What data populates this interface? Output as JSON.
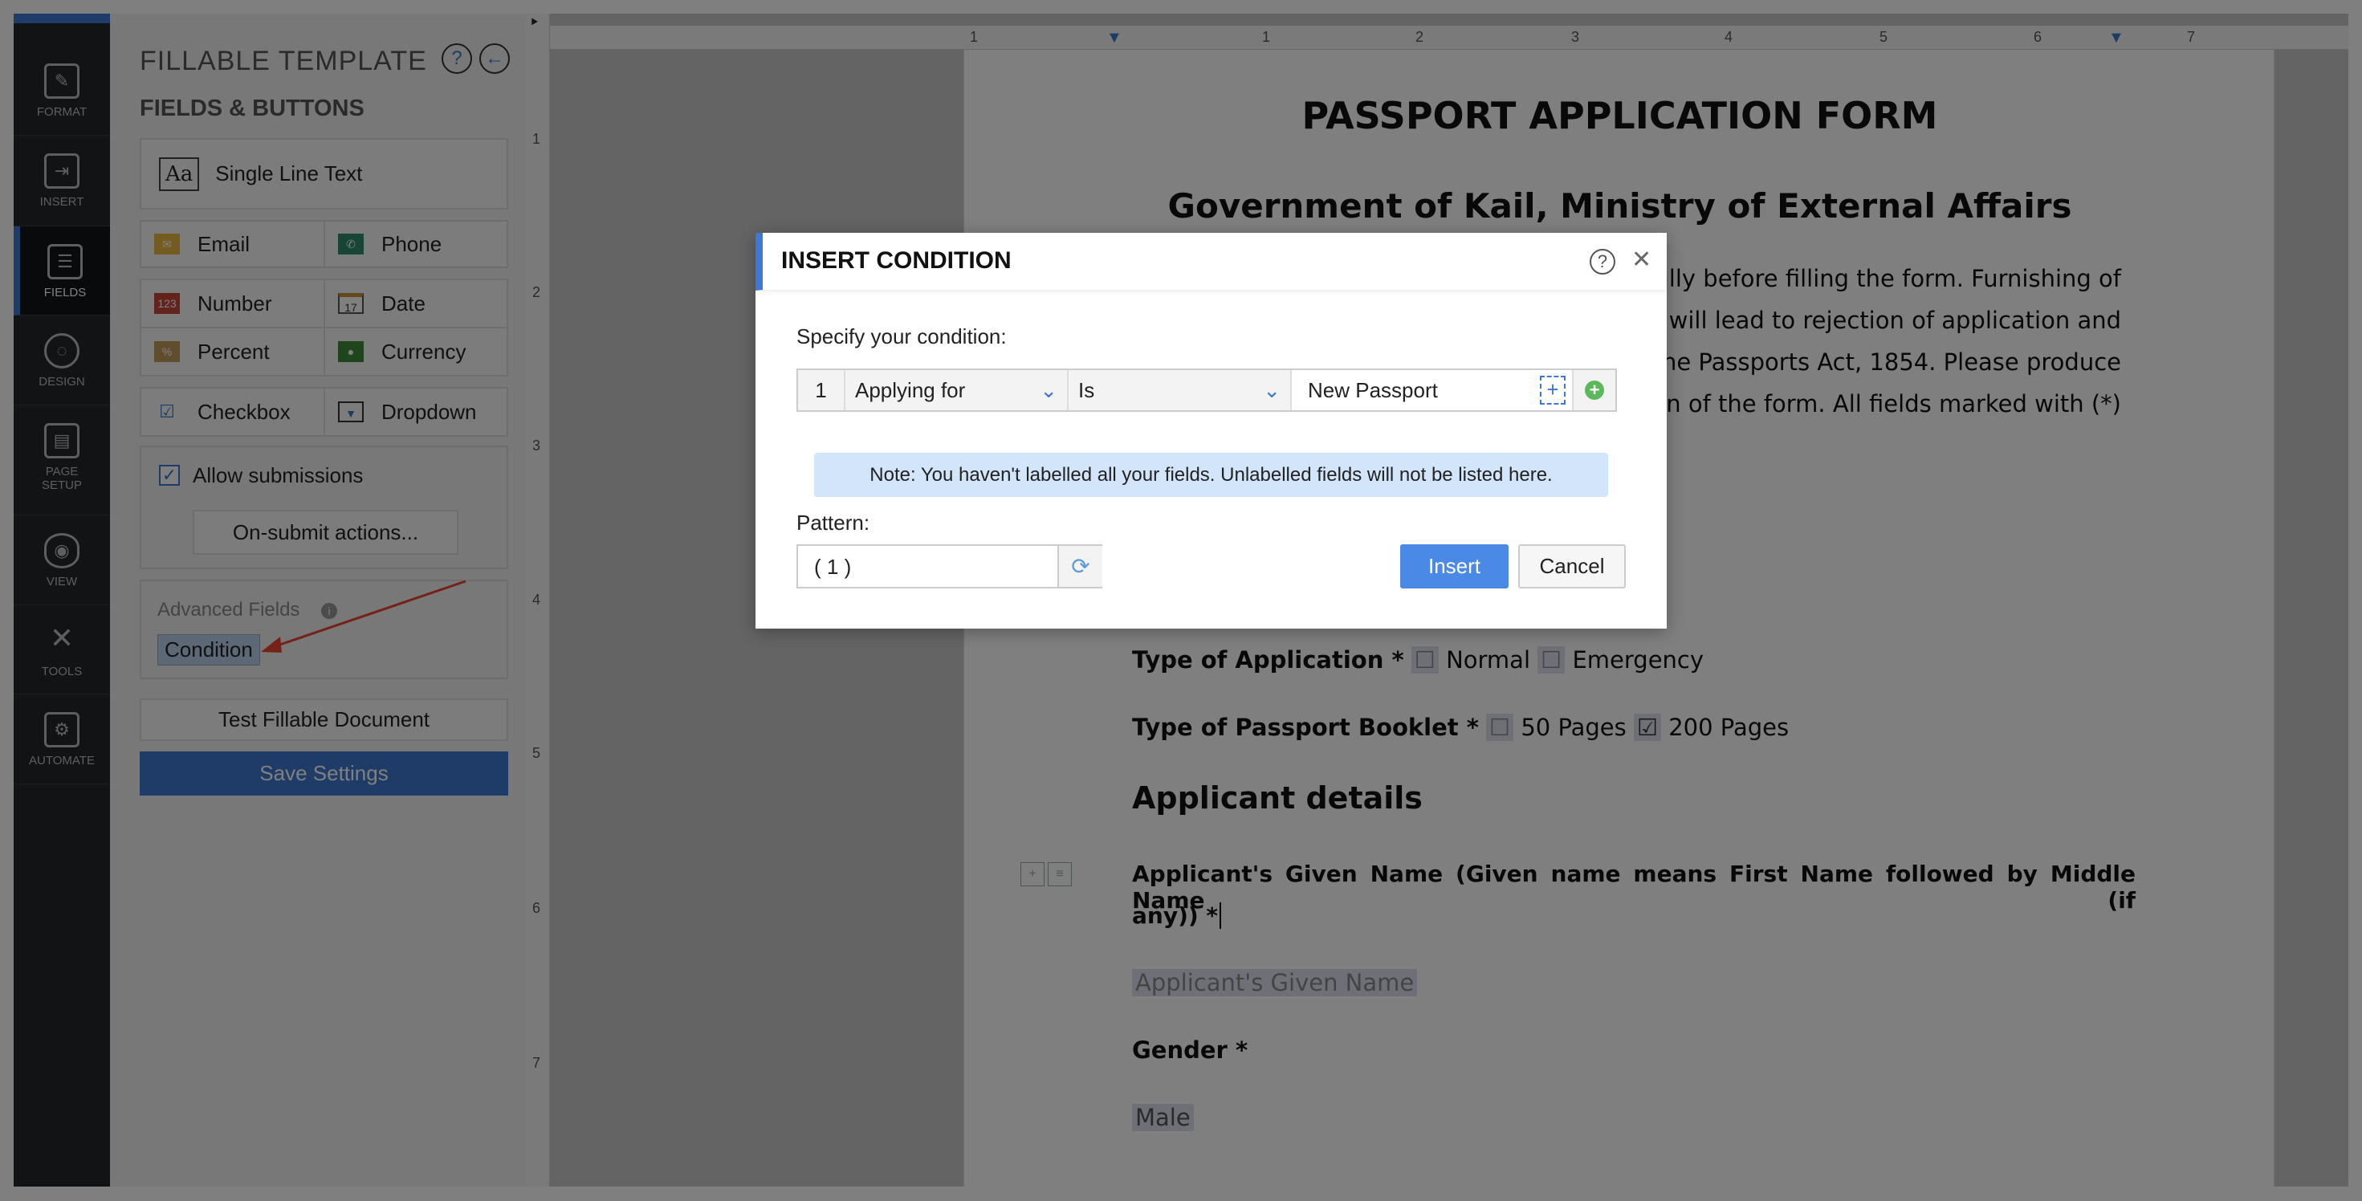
{
  "nav": [
    {
      "label": "FORMAT",
      "icon": "format-brush-icon"
    },
    {
      "label": "INSERT",
      "icon": "insert-icon"
    },
    {
      "label": "FIELDS",
      "icon": "fields-icon",
      "active": true
    },
    {
      "label": "DESIGN",
      "icon": "palette-icon"
    },
    {
      "label": "PAGE SETUP",
      "icon": "page-setup-icon"
    },
    {
      "label": "VIEW",
      "icon": "eye-icon"
    },
    {
      "label": "TOOLS",
      "icon": "tools-icon"
    },
    {
      "label": "AUTOMATE",
      "icon": "automate-icon"
    }
  ],
  "panel": {
    "title": "FILLABLE TEMPLATE",
    "subtitle": "FIELDS & BUTTONS",
    "single_line": "Single Line Text",
    "single_icon": "Aa",
    "fields": [
      "Email",
      "Phone",
      "Number",
      "Date",
      "Percent",
      "Currency",
      "Checkbox",
      "Dropdown"
    ],
    "number_icon": "123",
    "date_icon": "17",
    "percent_icon": "%",
    "allow_submissions": "Allow submissions",
    "allow_checked": true,
    "on_submit": "On-submit actions...",
    "advanced_label": "Advanced Fields",
    "condition": "Condition",
    "test": "Test Fillable Document",
    "save": "Save Settings"
  },
  "hruler": [
    "1",
    "1",
    "2",
    "3",
    "4",
    "5",
    "6",
    "7"
  ],
  "vruler": [
    "1",
    "2",
    "3",
    "4",
    "5",
    "6",
    "7"
  ],
  "doc": {
    "title": "PASSPORT APPLICATION FORM",
    "subtitle": "Government of Kail, Ministry of External Affairs",
    "para": [
      "fully before filling the form. Furnishing of",
      "will lead to rejection of application and",
      "r the Passports Act, 1854. Please produce",
      "on of the form. All fields marked with (*)"
    ],
    "type_app": "Type of Application *",
    "normal": "Normal",
    "emergency": "Emergency",
    "booklet": "Type of Passport Booklet *",
    "p50": "50 Pages",
    "p200": "200 Pages",
    "section": "Applicant details",
    "given_label_1": "Applicant's Given Name (Given name means First Name followed by Middle Name (if",
    "given_label_2": "any)) *",
    "given_field": "Applicant's Given Name",
    "gender": "Gender *",
    "gender_field": "Male"
  },
  "dialog": {
    "title": "INSERT CONDITION",
    "specify": "Specify your condition:",
    "row_no": "1",
    "field": "Applying for",
    "operator": "Is",
    "value": "New Passport",
    "note": "Note: You haven't labelled all your fields. Unlabelled fields will not be listed here.",
    "pattern_label": "Pattern:",
    "pattern": "( 1 )",
    "insert": "Insert",
    "cancel": "Cancel"
  },
  "colors": {
    "accent": "#3f78d1",
    "add": "#5cb85c",
    "annotation_arrow": "#e8442e"
  }
}
